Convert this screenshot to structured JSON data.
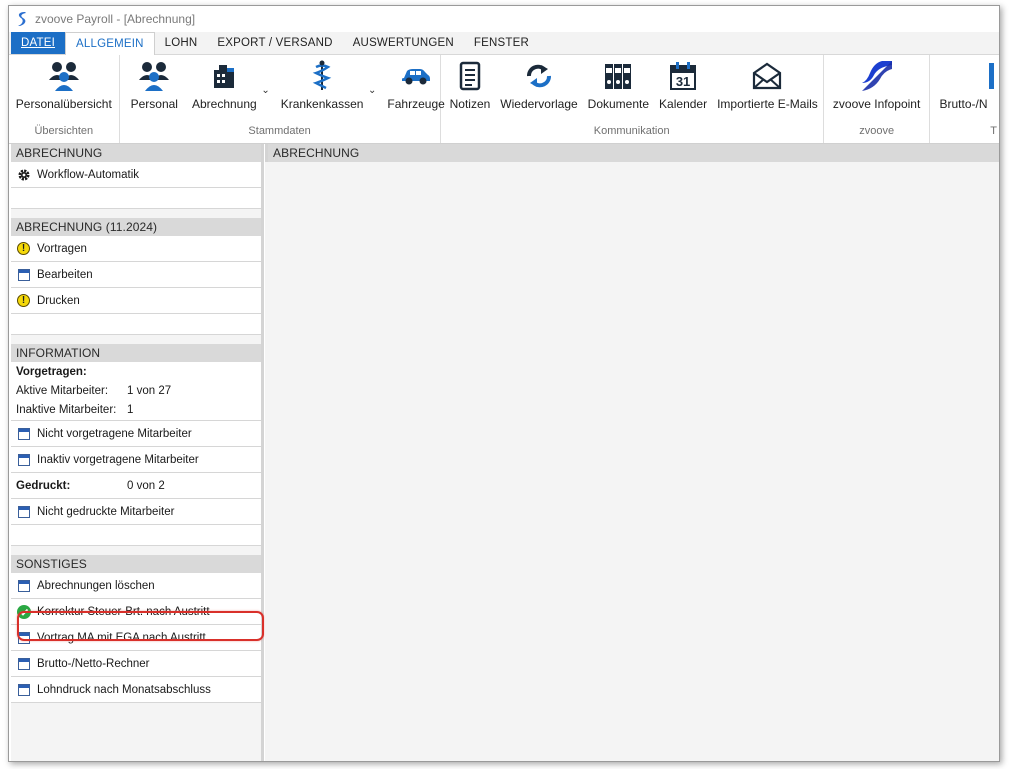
{
  "window": {
    "title": "zvoove Payroll - [Abrechnung]"
  },
  "menu": {
    "tabs": [
      "DATEI",
      "ALLGEMEIN",
      "LOHN",
      "EXPORT / VERSAND",
      "AUSWERTUNGEN",
      "FENSTER"
    ]
  },
  "ribbon": {
    "groups": [
      {
        "label": "Übersichten",
        "items": [
          {
            "label": "Personalübersicht",
            "icon": "people-group-icon"
          }
        ]
      },
      {
        "label": "Stammdaten",
        "items": [
          {
            "label": "Personal",
            "icon": "people-group-icon"
          },
          {
            "label": "Abrechnung",
            "icon": "building-icon"
          },
          {
            "label": "Krankenkassen",
            "icon": "caduceus-icon"
          },
          {
            "label": "Fahrzeuge",
            "icon": "car-icon"
          }
        ]
      },
      {
        "label": "Kommunikation",
        "items": [
          {
            "label": "Notizen",
            "icon": "notepad-icon"
          },
          {
            "label": "Wiedervorlage",
            "icon": "refresh-arrows-icon"
          },
          {
            "label": "Dokumente",
            "icon": "binders-icon"
          },
          {
            "label": "Kalender",
            "icon": "calendar-icon",
            "day": "31"
          },
          {
            "label": "Importierte E-Mails",
            "icon": "envelope-icon"
          }
        ]
      },
      {
        "label": "zvoove",
        "items": [
          {
            "label": "zvoove Infopoint",
            "icon": "zvoove-logo-icon"
          }
        ]
      },
      {
        "label": "",
        "items": [
          {
            "label": "Brutto-/N",
            "icon": "calculator-icon"
          }
        ]
      }
    ],
    "overflow_label": "T"
  },
  "sidebar": {
    "abrechnung": {
      "header": "ABRECHNUNG",
      "items": [
        {
          "label": "Workflow-Automatik",
          "icon": "gear-icon"
        }
      ]
    },
    "period": {
      "header": "ABRECHNUNG (11.2024)",
      "items": [
        {
          "label": "Vortragen",
          "icon": "warning-icon"
        },
        {
          "label": "Bearbeiten",
          "icon": "window-icon"
        },
        {
          "label": "Drucken",
          "icon": "warning-icon"
        }
      ]
    },
    "information": {
      "header": "INFORMATION",
      "vorgetragen_title": "Vorgetragen:",
      "aktive_label": "Aktive Mitarbeiter:",
      "aktive_value": "1 von 27",
      "inaktive_label": "Inaktive Mitarbeiter:",
      "inaktive_value": "1",
      "item1": "Nicht vorgetragene Mitarbeiter",
      "item2": "Inaktiv vorgetragene Mitarbeiter",
      "gedruckt_label": "Gedruckt:",
      "gedruckt_value": "0 von 2",
      "item3": "Nicht gedruckte Mitarbeiter"
    },
    "sonstiges": {
      "header": "SONSTIGES",
      "items": [
        {
          "label": "Abrechnungen löschen",
          "icon": "window-icon"
        },
        {
          "label": "Korrektur Steuer-Brt. nach Austritt",
          "icon": "check-circle-icon"
        },
        {
          "label": "Vortrag MA mit EGA nach Austritt",
          "icon": "window-icon"
        },
        {
          "label": "Brutto-/Netto-Rechner",
          "icon": "window-icon"
        },
        {
          "label": "Lohndruck nach Monatsabschluss",
          "icon": "window-icon"
        }
      ]
    }
  },
  "main": {
    "header": "ABRECHNUNG"
  },
  "colors": {
    "accent": "#1c6fc6",
    "highlight": "#d9302a",
    "warning": "#f5d90a",
    "success": "#2aa843"
  }
}
